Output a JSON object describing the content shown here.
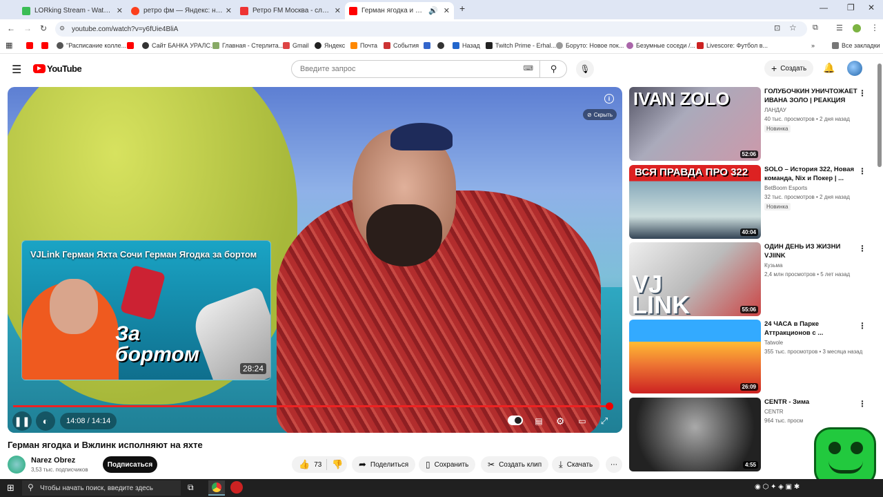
{
  "browser": {
    "tabs": [
      {
        "title": "LORking Stream - Watch Live o",
        "color": "#3bbd55"
      },
      {
        "title": "ретро фм — Яндекс: нашлось",
        "color": "#fc3f1d"
      },
      {
        "title": "Ретро FM Москва - слушать о",
        "color": "#e33"
      },
      {
        "title": "Герман ягодка и Вжлинк и",
        "color": "#f00"
      }
    ],
    "url": "youtube.com/watch?v=y6fUie4BliA",
    "bookmarks": [
      "\"Расписание колле...",
      "Сайт БАНКА УРАЛС...",
      "Главная - Стерлита...",
      "Gmail",
      "Яндекс",
      "Почта",
      "События",
      "Назад",
      "Twitch Prime - Erhal...",
      "Боруто: Новое пок...",
      "Безумные соседи /...",
      "Livescore: Футбол в..."
    ],
    "all_bookmarks": "Все закладки"
  },
  "youtube": {
    "logo": "YouTube",
    "search_placeholder": "Введите запрос",
    "create": "Создать"
  },
  "player": {
    "endcard_title": "VJLink Герман Яхта Сочи Герман Ягодка за бортом",
    "endcard_text": "За бортом",
    "endcard_duration": "28:24",
    "hide": "Скрыть",
    "info": "i",
    "time": "14:08 / 14:14",
    "progress": 0.993
  },
  "video": {
    "title": "Герман ягодка и Вжлинк исполняют на яхте",
    "channel": "Narez Obrez",
    "subs": "3,53 тыс. подписчиков",
    "subscribe": "Подписаться",
    "likes": "73",
    "share": "Поделиться",
    "save": "Сохранить",
    "clip": "Создать клип",
    "download": "Скачать"
  },
  "recommendations": [
    {
      "title": "ГОЛУБОЧКИН УНИЧТОЖАЕТ ИВАНА ЗОЛО | РЕАКЦИЯ",
      "channel": "ЛАНДАУ",
      "meta": "40 тыс. просмотров • 2 дня назад",
      "badge": "Новинка",
      "duration": "52:06",
      "thumb": "IVAN ZOLO"
    },
    {
      "title": "SOLO – История 322, Новая команда, Nix и Покер | ...",
      "channel": "BetBoom Esports",
      "meta": "32 тыс. просмотров • 2 дня назад",
      "badge": "Новинка",
      "duration": "40:04",
      "thumb": "ВСЯ ПРАВДА ПРО 322"
    },
    {
      "title": "ОДИН ДЕНЬ ИЗ ЖИЗНИ VJIINK",
      "channel": "Кузьма",
      "meta": "2,4 млн просмотров • 5 лет назад",
      "badge": "",
      "duration": "55:06",
      "thumb": "VJ LINK"
    },
    {
      "title": "24 ЧАСА в Парке Аттракционов с ...",
      "channel": "Tatwole",
      "meta": "355 тыс. просмотров • 3 месяца назад",
      "badge": "",
      "duration": "26:09",
      "thumb": ""
    },
    {
      "title": "CENTR - Зима",
      "channel": "CENTR",
      "meta": "964 тыс. просм",
      "badge": "",
      "duration": "4:55",
      "thumb": ""
    }
  ],
  "taskbar": {
    "search_placeholder": "Чтобы начать поиск, введите здесь"
  }
}
